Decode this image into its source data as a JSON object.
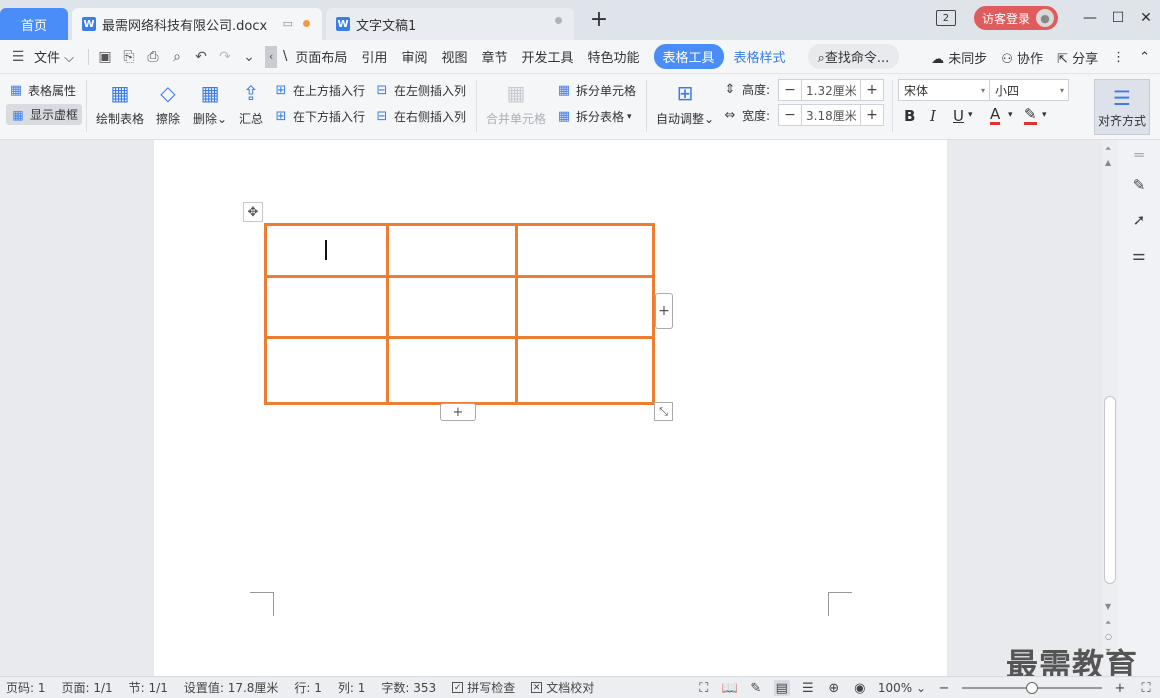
{
  "tabs": {
    "home": "首页",
    "active_doc": "最需网络科技有限公司.docx",
    "other_doc": "文字文稿1",
    "add": "+"
  },
  "window": {
    "badge_count": "2",
    "login": "访客登录",
    "minimize": "—",
    "maximize": "☐",
    "close": "✕"
  },
  "menu": {
    "file": "文件",
    "items": [
      "页面布局",
      "引用",
      "审阅",
      "视图",
      "章节",
      "开发工具",
      "特色功能"
    ],
    "active_tab": "表格工具",
    "table_style": "表格样式",
    "search": "查找命令...",
    "sync": "未同步",
    "collab": "协作",
    "share": "分享"
  },
  "ribbon": {
    "table_props": "表格属性",
    "show_grid": "显示虚框",
    "draw_table": "绘制表格",
    "erase": "擦除",
    "delete": "删除",
    "summary": "汇总",
    "insert_above": "在上方插入行",
    "insert_below": "在下方插入行",
    "insert_left": "在左侧插入列",
    "insert_right": "在右侧插入列",
    "merge_cells": "合并单元格",
    "split_cells": "拆分单元格",
    "split_table": "拆分表格",
    "auto_fit": "自动调整",
    "height_label": "高度:",
    "height_value": "1.32厘米",
    "width_label": "宽度:",
    "width_value": "3.18厘米",
    "font_name": "宋体",
    "font_size": "小四",
    "bold": "B",
    "italic": "I",
    "underline": "U",
    "font_color": "A",
    "align": "对齐方式"
  },
  "table": {
    "rows": 3,
    "cols": 3,
    "border_color": "#ed7d31"
  },
  "status": {
    "page_num": "页码: 1",
    "pages": "页面: 1/1",
    "section": "节: 1/1",
    "setting": "设置值: 17.8厘米",
    "row": "行: 1",
    "col": "列: 1",
    "words": "字数: 353",
    "spell": "拼写检查",
    "proof": "文档校对",
    "zoom": "100%"
  },
  "watermark": "最需教育",
  "colors": {
    "accent": "#4b8df8",
    "login_red": "#e05c5c",
    "table_orange": "#ed7d31"
  }
}
